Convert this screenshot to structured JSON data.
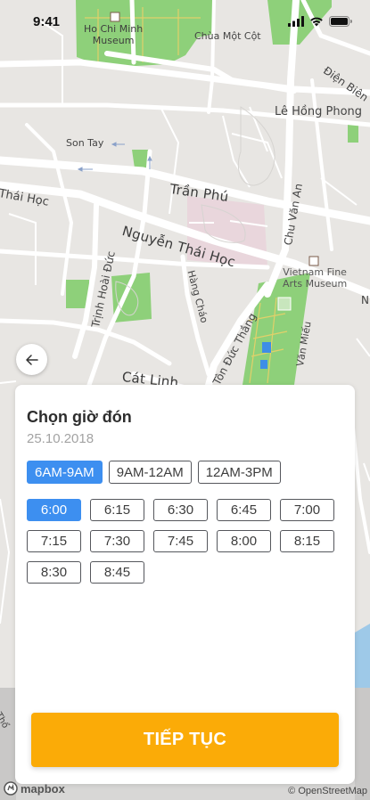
{
  "status_bar": {
    "time": "9:41"
  },
  "map": {
    "labels": {
      "ho_chi_minh_museum": [
        "Ho Chi Minh",
        "Museum"
      ],
      "chua_mot_cot": "Chùa Một Cột",
      "dien_bien": "Điện Biên",
      "le_hong_phong": "Lê Hồng Phong",
      "son_tay": "Son Tay",
      "tran_phu": "Trần Phú",
      "thai_hoc": "Thái Học",
      "chu_van_an": "Chu Văn An",
      "nguyen_thai_hoc": "Nguyễn Thái Học",
      "vietnam_fine_arts": [
        "Vietnam Fine",
        "Arts Museum"
      ],
      "trinh_hoai_duc": "Trịnh Hoài Đức",
      "hang_chao": "Hàng Cháo",
      "ton_duc_thang": "Tôn Đức Thắng",
      "van_mieu": "Văn Miếu",
      "cat_linh": "Cát Linh",
      "tho_partial": "Thổ",
      "n_partial": "N"
    }
  },
  "sheet": {
    "title": "Chọn giờ đón",
    "date": "25.10.2018",
    "ranges": [
      {
        "label": "6AM-9AM",
        "active": true
      },
      {
        "label": "9AM-12AM",
        "active": false
      },
      {
        "label": "12AM-3PM",
        "active": false
      }
    ],
    "slots": [
      {
        "label": "6:00",
        "active": true
      },
      {
        "label": "6:15",
        "active": false
      },
      {
        "label": "6:30",
        "active": false
      },
      {
        "label": "6:45",
        "active": false
      },
      {
        "label": "7:00",
        "active": false
      },
      {
        "label": "7:15",
        "active": false
      },
      {
        "label": "7:30",
        "active": false
      },
      {
        "label": "7:45",
        "active": false
      },
      {
        "label": "8:00",
        "active": false
      },
      {
        "label": "8:15",
        "active": false
      },
      {
        "label": "8:30",
        "active": false
      },
      {
        "label": "8:45",
        "active": false
      }
    ],
    "continue_label": "TIẾP TỤC"
  },
  "attribution": {
    "mapbox": "mapbox",
    "osm": "© OpenStreetMap"
  },
  "colors": {
    "accent": "#3d8ff0",
    "cta": "#fbab07",
    "park": "#8ed07a",
    "museum_area": "#e9d6dc"
  },
  "icons": [
    "back-arrow-icon",
    "signal-icon",
    "wifi-icon",
    "battery-icon",
    "museum-icon",
    "mapbox-logo-icon"
  ]
}
